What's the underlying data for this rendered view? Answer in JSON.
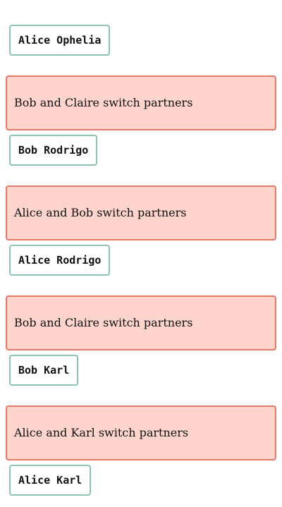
{
  "sequence": [
    {
      "kind": "state",
      "text": "Alice Ophelia"
    },
    {
      "kind": "step",
      "text": "Bob and Claire switch partners"
    },
    {
      "kind": "state",
      "text": "Bob Rodrigo"
    },
    {
      "kind": "step",
      "text": "Alice and Bob switch partners"
    },
    {
      "kind": "state",
      "text": "Alice Rodrigo"
    },
    {
      "kind": "step",
      "text": "Bob and Claire switch partners"
    },
    {
      "kind": "state",
      "text": "Bob Karl"
    },
    {
      "kind": "step",
      "text": "Alice and Karl switch partners"
    },
    {
      "kind": "state",
      "text": "Alice Karl"
    }
  ],
  "colors": {
    "state_border": "#8ec3ad",
    "step_border": "#e8796a",
    "step_fill": "#ffd4cd"
  }
}
